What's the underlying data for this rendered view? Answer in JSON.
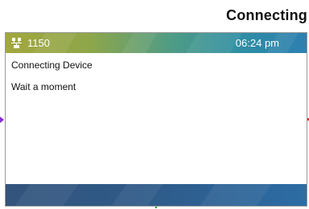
{
  "page": {
    "heading": "Connecting"
  },
  "status_bar": {
    "icon": "network-extension-icon",
    "extension": "1150",
    "time": "06:24 pm"
  },
  "content": {
    "lines": [
      "Connecting Device",
      "Wait a moment"
    ]
  },
  "softkey_bar": {
    "labels": []
  },
  "colors": {
    "status_bar_start": "#a3a73e",
    "status_bar_end": "#2e7fb0",
    "softkey_bar": "#2f5a88"
  }
}
